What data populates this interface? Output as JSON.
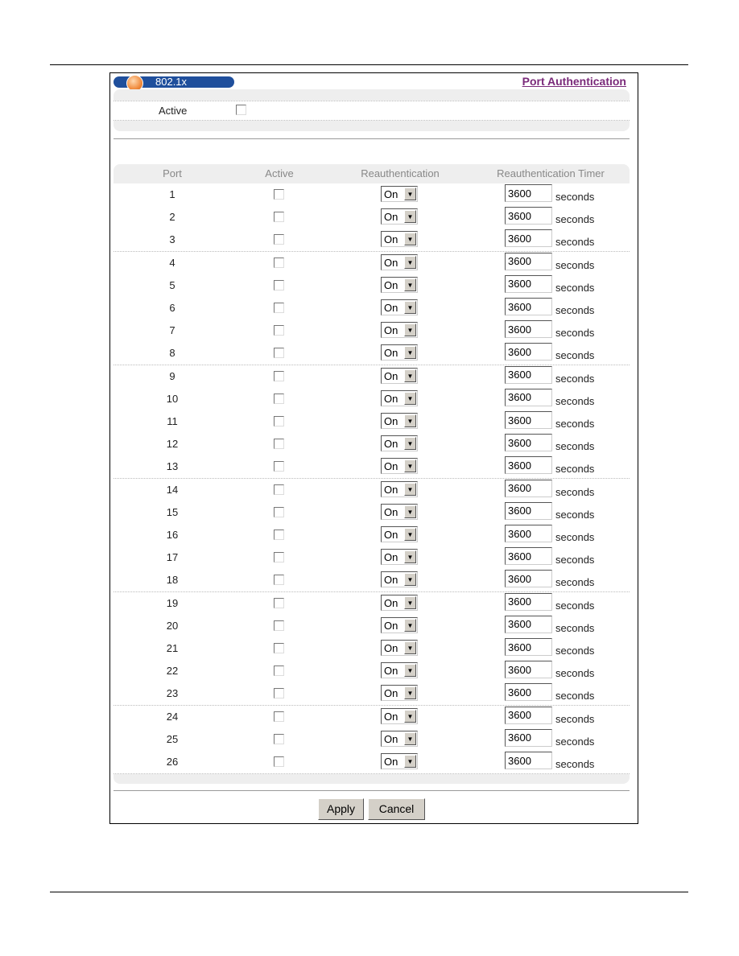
{
  "header": {
    "section_label": "802.1x",
    "page_link": "Port Authentication"
  },
  "global": {
    "active_label": "Active",
    "active_checked": false
  },
  "table": {
    "columns": [
      "Port",
      "Active",
      "Reauthentication",
      "Reauthentication Timer"
    ],
    "unit_label": "seconds",
    "rows": [
      {
        "port": "1",
        "active": false,
        "reauth": "On",
        "timer": "3600"
      },
      {
        "port": "2",
        "active": false,
        "reauth": "On",
        "timer": "3600"
      },
      {
        "port": "3",
        "active": false,
        "reauth": "On",
        "timer": "3600"
      },
      {
        "port": "4",
        "active": false,
        "reauth": "On",
        "timer": "3600"
      },
      {
        "port": "5",
        "active": false,
        "reauth": "On",
        "timer": "3600"
      },
      {
        "port": "6",
        "active": false,
        "reauth": "On",
        "timer": "3600"
      },
      {
        "port": "7",
        "active": false,
        "reauth": "On",
        "timer": "3600"
      },
      {
        "port": "8",
        "active": false,
        "reauth": "On",
        "timer": "3600"
      },
      {
        "port": "9",
        "active": false,
        "reauth": "On",
        "timer": "3600"
      },
      {
        "port": "10",
        "active": false,
        "reauth": "On",
        "timer": "3600"
      },
      {
        "port": "11",
        "active": false,
        "reauth": "On",
        "timer": "3600"
      },
      {
        "port": "12",
        "active": false,
        "reauth": "On",
        "timer": "3600"
      },
      {
        "port": "13",
        "active": false,
        "reauth": "On",
        "timer": "3600"
      },
      {
        "port": "14",
        "active": false,
        "reauth": "On",
        "timer": "3600"
      },
      {
        "port": "15",
        "active": false,
        "reauth": "On",
        "timer": "3600"
      },
      {
        "port": "16",
        "active": false,
        "reauth": "On",
        "timer": "3600"
      },
      {
        "port": "17",
        "active": false,
        "reauth": "On",
        "timer": "3600"
      },
      {
        "port": "18",
        "active": false,
        "reauth": "On",
        "timer": "3600"
      },
      {
        "port": "19",
        "active": false,
        "reauth": "On",
        "timer": "3600"
      },
      {
        "port": "20",
        "active": false,
        "reauth": "On",
        "timer": "3600"
      },
      {
        "port": "21",
        "active": false,
        "reauth": "On",
        "timer": "3600"
      },
      {
        "port": "22",
        "active": false,
        "reauth": "On",
        "timer": "3600"
      },
      {
        "port": "23",
        "active": false,
        "reauth": "On",
        "timer": "3600"
      },
      {
        "port": "24",
        "active": false,
        "reauth": "On",
        "timer": "3600"
      },
      {
        "port": "25",
        "active": false,
        "reauth": "On",
        "timer": "3600"
      },
      {
        "port": "26",
        "active": false,
        "reauth": "On",
        "timer": "3600"
      }
    ]
  },
  "buttons": {
    "apply": "Apply",
    "cancel": "Cancel"
  },
  "colors": {
    "header_pill": "#1f4f9c",
    "link": "#7a2a7a",
    "panel": "#eeeeee"
  }
}
